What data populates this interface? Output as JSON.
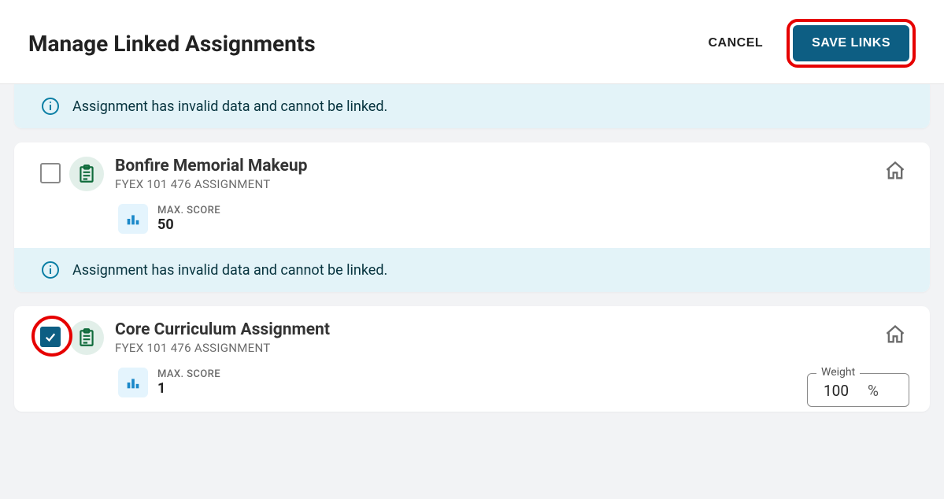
{
  "header": {
    "title": "Manage Linked Assignments",
    "cancel_label": "CANCEL",
    "save_label": "SAVE LINKS"
  },
  "messages": {
    "invalid": "Assignment has invalid data and cannot be linked."
  },
  "labels": {
    "max_score": "MAX. SCORE",
    "weight": "Weight",
    "percent": "%"
  },
  "assignments": [
    {
      "title": "Bonfire Memorial Makeup",
      "subtitle": "FYEX 101 476 ASSIGNMENT",
      "max_score": "50",
      "checked": false,
      "invalid": true
    },
    {
      "title": "Core Curriculum Assignment",
      "subtitle": "FYEX 101 476 ASSIGNMENT",
      "max_score": "1",
      "checked": true,
      "invalid": false,
      "weight": "100"
    }
  ]
}
